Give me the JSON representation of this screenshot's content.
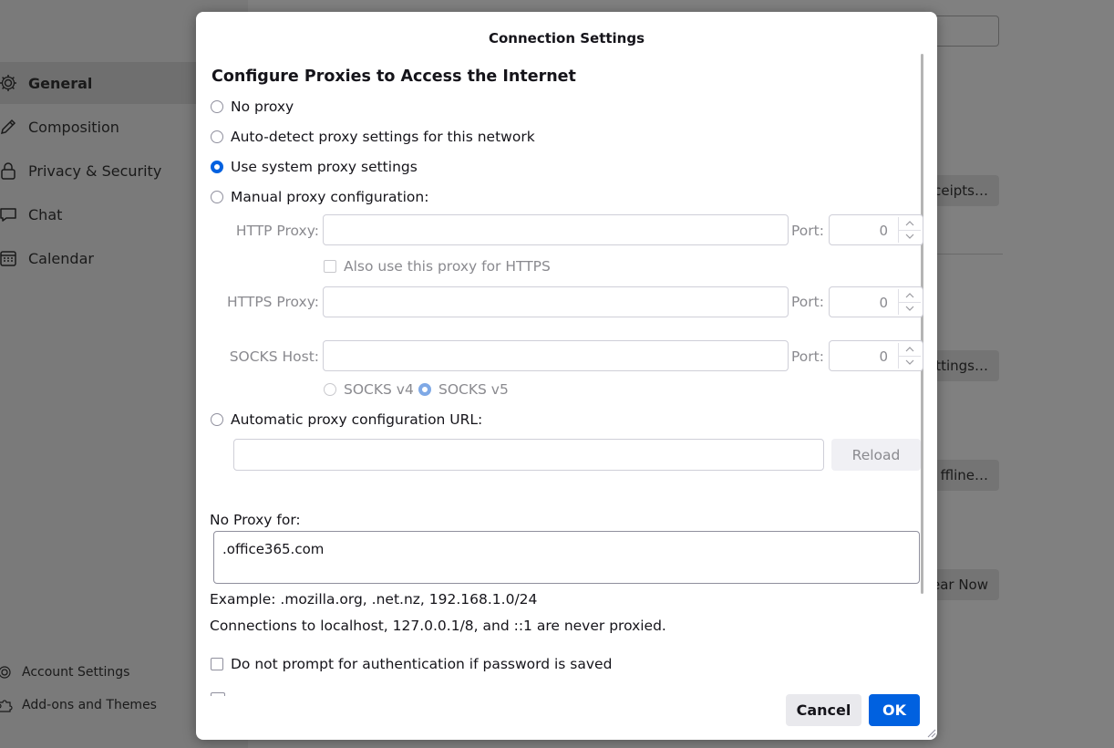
{
  "sidebar": {
    "items": [
      {
        "label": "General",
        "icon": "gear-icon",
        "selected": true
      },
      {
        "label": "Composition",
        "icon": "pencil-icon",
        "selected": false
      },
      {
        "label": "Privacy & Security",
        "icon": "lock-icon",
        "selected": false
      },
      {
        "label": "Chat",
        "icon": "chat-icon",
        "selected": false
      },
      {
        "label": "Calendar",
        "icon": "calendar-icon",
        "selected": false
      }
    ],
    "footer": {
      "account_settings": "Account Settings",
      "addons": "Add-ons and Themes"
    }
  },
  "background": {
    "receipts_button": "ceipts…",
    "settings_button": "ttings…",
    "offline_button": "ffline…",
    "clear_button": "ear Now"
  },
  "dialog": {
    "title": "Connection Settings",
    "heading": "Configure Proxies to Access the Internet",
    "options": {
      "no_proxy": "No proxy",
      "auto_detect": "Auto-detect proxy settings for this network",
      "system": "Use system proxy settings",
      "manual": "Manual proxy configuration:",
      "auto_url": "Automatic proxy configuration URL:"
    },
    "selected_option": "system",
    "http_proxy": {
      "label": "HTTP Proxy:",
      "value": "",
      "port_label": "Port:",
      "port": "0"
    },
    "also_https": "Also use this proxy for HTTPS",
    "https_proxy": {
      "label": "HTTPS Proxy:",
      "value": "",
      "port_label": "Port:",
      "port": "0"
    },
    "socks_host": {
      "label": "SOCKS Host:",
      "value": "",
      "port_label": "Port:",
      "port": "0"
    },
    "socks_v4": "SOCKS v4",
    "socks_v5": "SOCKS v5",
    "socks_selected": "v5",
    "auto_url_value": "",
    "reload_button": "Reload",
    "no_proxy_for_label": "No Proxy for:",
    "no_proxy_for_value": ".office365.com",
    "example_text": "Example: .mozilla.org, .net.nz, 192.168.1.0/24",
    "localhost_note": "Connections to localhost, 127.0.0.1/8, and ::1 are never proxied.",
    "no_prompt_auth": "Do not prompt for authentication if password is saved",
    "cancel_button": "Cancel",
    "ok_button": "OK"
  },
  "colors": {
    "accent": "#0061e0",
    "overlay_bg": "#7a7a7a",
    "dialog_bg": "#ffffff",
    "disabled_text": "#8a8a8f"
  }
}
